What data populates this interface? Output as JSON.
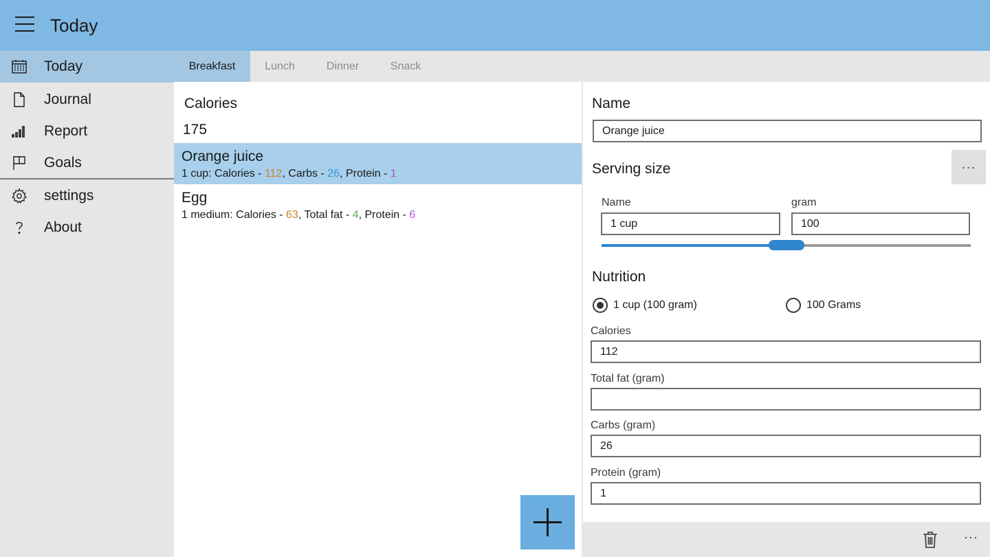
{
  "app": {
    "title": "Today"
  },
  "sidebar": {
    "items": [
      {
        "label": "Today",
        "icon": "calendar-icon",
        "active": true
      },
      {
        "label": "Journal",
        "icon": "document-icon"
      },
      {
        "label": "Report",
        "icon": "bar-chart-icon"
      },
      {
        "label": "Goals",
        "icon": "flag-icon"
      },
      {
        "label": "settings",
        "icon": "gear-icon"
      },
      {
        "label": "About",
        "icon": "question-icon"
      }
    ]
  },
  "tabs": [
    {
      "label": "Breakfast",
      "active": true
    },
    {
      "label": "Lunch"
    },
    {
      "label": "Dinner"
    },
    {
      "label": "Snack"
    }
  ],
  "meal": {
    "calories_label": "Calories",
    "calories_value": "175",
    "items": [
      {
        "name": "Orange juice",
        "detail": {
          "serving": "1 cup: ",
          "n1_label": "Calories - ",
          "n1_value": "112",
          "n2_label": ", Carbs - ",
          "n2_value": "26",
          "n3_label": ", Protein - ",
          "n3_value": "1"
        },
        "selected": true
      },
      {
        "name": "Egg",
        "detail": {
          "serving": "1 medium: ",
          "n1_label": "Calories - ",
          "n1_value": "63",
          "n2_label": ", Total fat - ",
          "n2_value": "4",
          "n3_label": ", Protein - ",
          "n3_value": "6"
        }
      }
    ]
  },
  "detail": {
    "name_label": "Name",
    "name_value": "Orange juice",
    "serving_label": "Serving size",
    "more_label": "···",
    "serving_name_label": "Name",
    "serving_name_value": "1 cup",
    "gram_label": "gram",
    "gram_value": "100",
    "slider_fraction": 0.5,
    "nutrition_label": "Nutrition",
    "radio_1_label": "1 cup (100 gram)",
    "radio_2_label": "100  Grams",
    "radio_selected": 1,
    "calories_label": "Calories",
    "calories_value": "112",
    "fat_label": "Total fat (gram)",
    "fat_value": "",
    "carbs_label": "Carbs (gram)",
    "carbs_value": "26",
    "protein_label": "Protein (gram)",
    "protein_value": "1"
  },
  "commandbar": {
    "more_label": "···"
  },
  "colors": {
    "titlebar": "#7fb8e2",
    "selection": "#a8cfeb",
    "accent": "#2f86cc",
    "calories": "#c8842b",
    "carbs": "#2b9bd8",
    "fat": "#4caf50",
    "protein": "#b253c8"
  }
}
